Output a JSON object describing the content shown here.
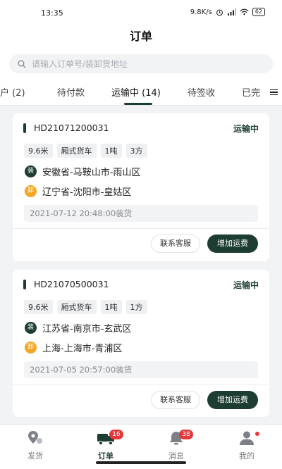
{
  "status_bar": {
    "time": "13:35",
    "speed": "9.8K/s",
    "battery": "62"
  },
  "header": {
    "title": "订单"
  },
  "search": {
    "placeholder": "请输入订单号/装卸货地址"
  },
  "tabs": [
    {
      "label": "户 (2)"
    },
    {
      "label": "待付款"
    },
    {
      "label": "运输中 (14)",
      "active": true
    },
    {
      "label": "待签收"
    },
    {
      "label": "已完"
    }
  ],
  "orders": [
    {
      "order_no": "HD21071200031",
      "status": "运输中",
      "tags": [
        "9.6米",
        "厢式货车",
        "1吨",
        "3方"
      ],
      "load_badge": "装",
      "load_address": "安徽省-马鞍山市-雨山区",
      "unload_badge": "卸",
      "unload_address": "辽宁省-沈阳市-皇姑区",
      "load_time": "2021-07-12 20:48:00装货",
      "contact_label": "联系客服",
      "add_fee_label": "增加运费"
    },
    {
      "order_no": "HD21070500031",
      "status": "运输中",
      "tags": [
        "9.6米",
        "厢式货车",
        "1吨",
        "1方"
      ],
      "load_badge": "装",
      "load_address": "江苏省-南京市-玄武区",
      "unload_badge": "卸",
      "unload_address": "上海-上海市-青浦区",
      "load_time": "2021-07-05 20:57:00装货",
      "contact_label": "联系客服",
      "add_fee_label": "增加运费"
    }
  ],
  "bottom_nav": [
    {
      "label": "发货",
      "icon": "location-pin-icon"
    },
    {
      "label": "订单",
      "icon": "truck-icon",
      "badge": "16",
      "active": true
    },
    {
      "label": "消息",
      "icon": "bell-icon",
      "badge": "38"
    },
    {
      "label": "我的",
      "icon": "user-icon",
      "dot": true
    }
  ],
  "colors": {
    "accent": "#1d3d33",
    "badge_red": "#e5383b",
    "unload_orange": "#f5a623"
  }
}
